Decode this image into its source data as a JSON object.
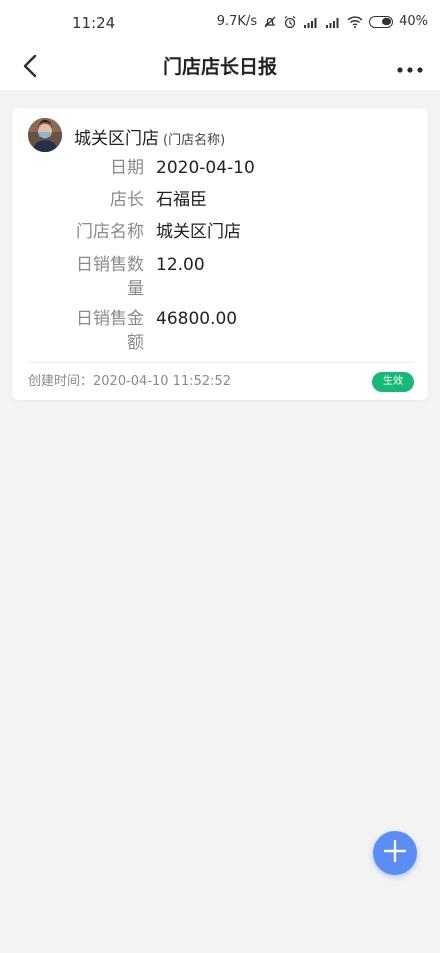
{
  "status_bar": {
    "time": "11:24",
    "net_speed": "9.7K/s",
    "battery": "40%"
  },
  "nav": {
    "title": "门店店长日报",
    "back_icon": "chevron-left-icon",
    "more_icon": "more-horizontal-icon"
  },
  "card": {
    "store_name": "城关区门店",
    "store_sub": "(门店名称)",
    "fields": [
      {
        "label": "日期",
        "value": "2020-04-10"
      },
      {
        "label": "店长",
        "value": "石福臣"
      },
      {
        "label": "门店名称",
        "value": "城关区门店"
      },
      {
        "label": "日销售数量",
        "value": "12.00"
      },
      {
        "label": "日销售金额",
        "value": "46800.00"
      }
    ],
    "created": "创建时间：2020-04-10 11:52:52",
    "status": "生效"
  },
  "fab": {
    "icon": "plus-icon"
  },
  "colors": {
    "badge": "#17b87a",
    "fab": "#5b8ef4",
    "background": "#f3f3f3"
  }
}
